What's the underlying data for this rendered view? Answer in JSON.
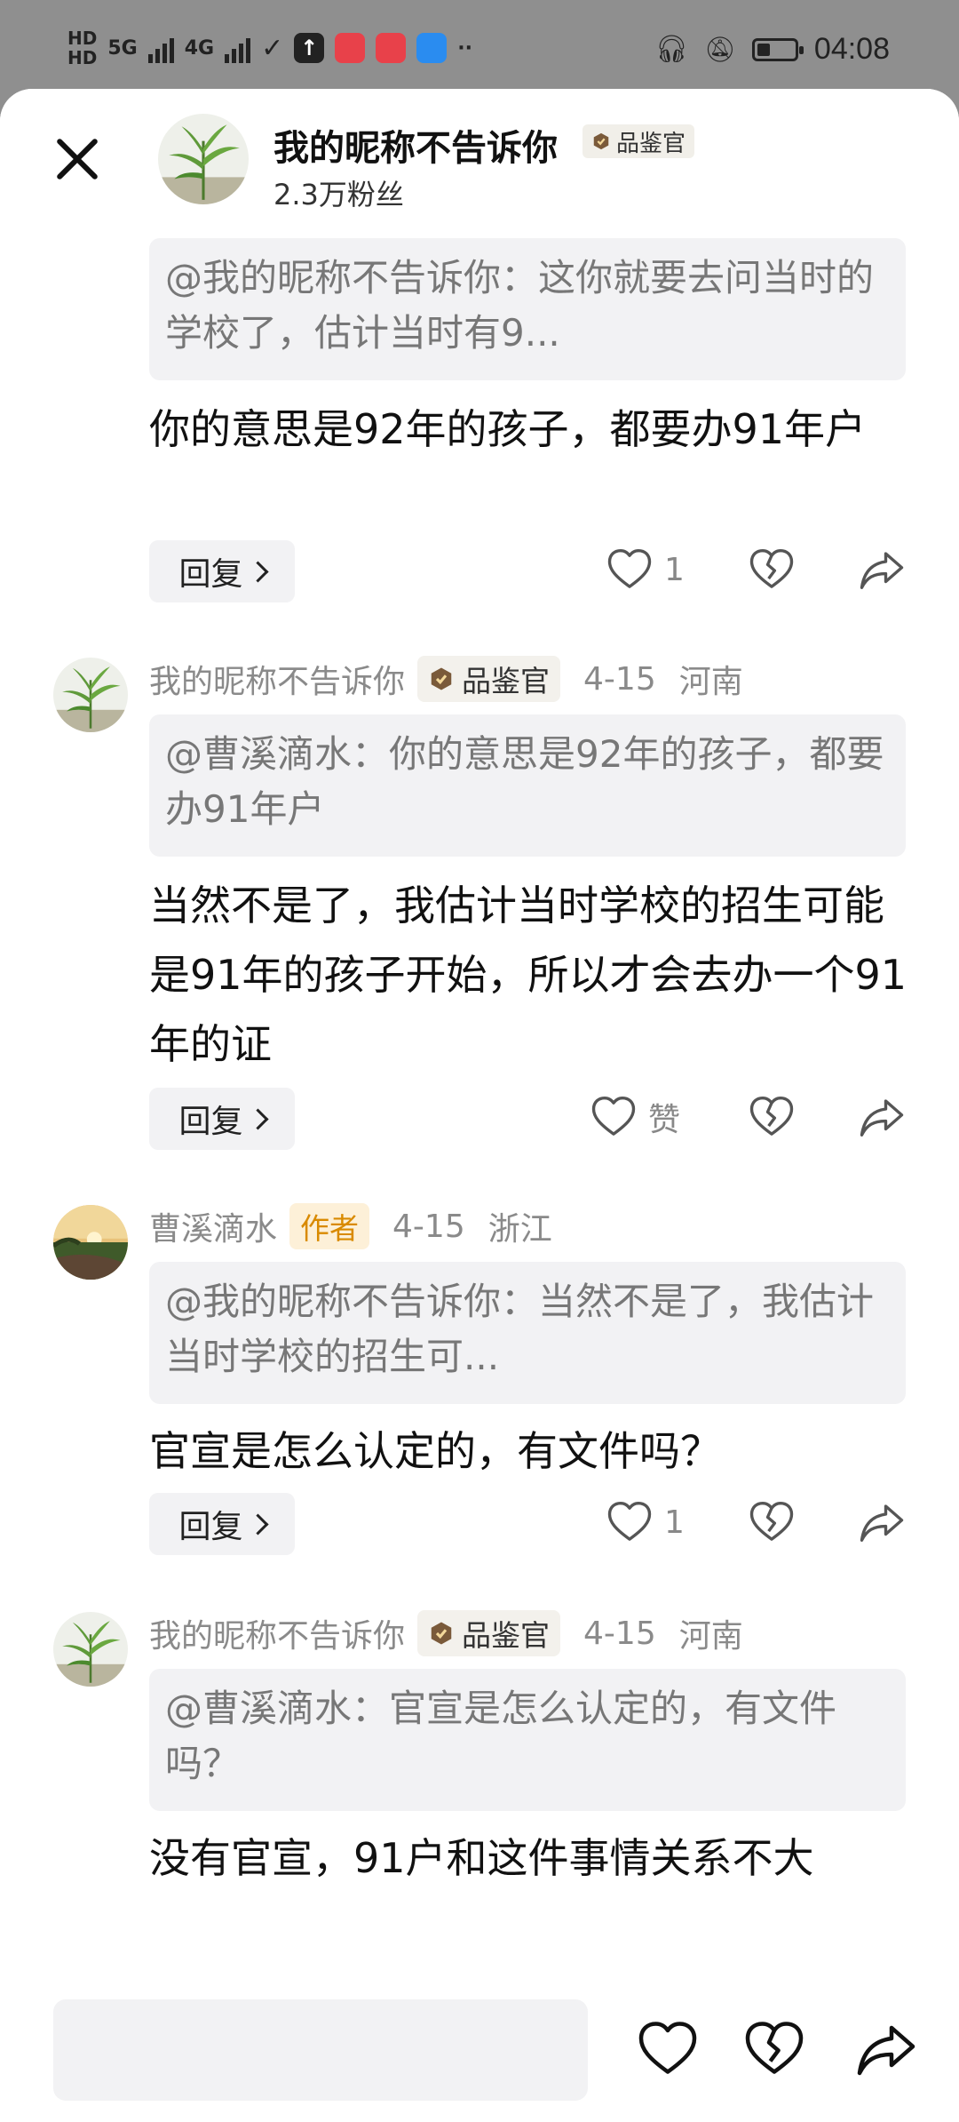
{
  "status": {
    "hd1": "HD",
    "hd2": "HD",
    "net1": "5G",
    "net2": "4G",
    "time": "04:08"
  },
  "header": {
    "close": "close",
    "name": "我的昵称不告诉你",
    "badge": "品鉴官",
    "fans": "2.3万粉丝"
  },
  "comments": [
    {
      "quote": "@我的昵称不告诉你：这你就要去问当时的学校了，估计当时有9...",
      "text": "你的意思是92年的孩子，都要办91年户",
      "reply": "回复",
      "likes": "1"
    },
    {
      "name": "我的昵称不告诉你",
      "badge": "品鉴官",
      "date": "4-15",
      "location": "河南",
      "quote": "@曹溪滴水：你的意思是92年的孩子，都要办91年户",
      "text": "当然不是了，我估计当时学校的招生可能是91年的孩子开始，所以才会去办一个91年的证",
      "reply": "回复",
      "likes": "赞"
    },
    {
      "name": "曹溪滴水",
      "badge": "作者",
      "date": "4-15",
      "location": "浙江",
      "quote": "@我的昵称不告诉你：当然不是了，我估计当时学校的招生可...",
      "text": "官宣是怎么认定的，有文件吗？",
      "reply": "回复",
      "likes": "1"
    },
    {
      "name": "我的昵称不告诉你",
      "badge": "品鉴官",
      "date": "4-15",
      "location": "河南",
      "quote": "@曹溪滴水：官宣是怎么认定的，有文件吗？",
      "text": "没有官宣，91户和这件事情关系不大"
    }
  ],
  "colors": {
    "accent_author": "#d98a00",
    "quote_bg": "#f2f2f4"
  }
}
